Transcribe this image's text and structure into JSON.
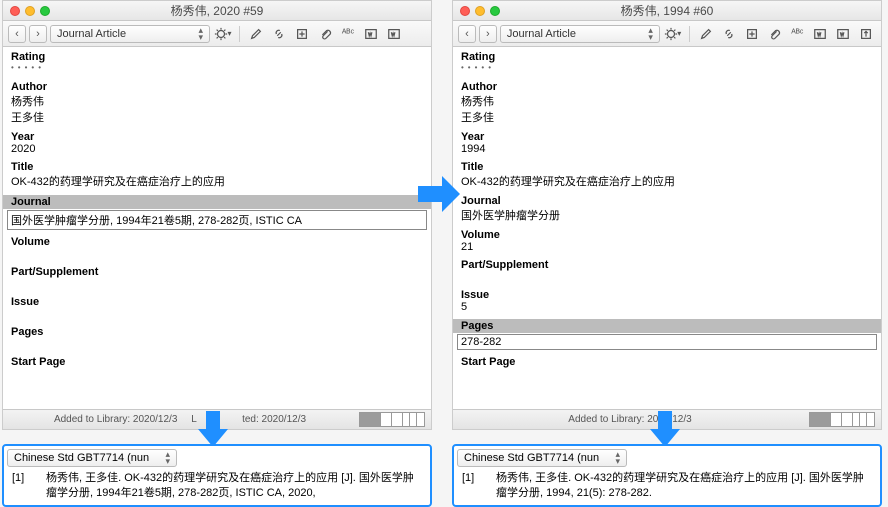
{
  "left": {
    "window_title": "杨秀伟, 2020 #59",
    "ref_type": "Journal Article",
    "fields": {
      "rating_label": "Rating",
      "author_label": "Author",
      "author1": "杨秀伟",
      "author2": "王多佳",
      "year_label": "Year",
      "year": "2020",
      "title_label": "Title",
      "title": "OK-432的药理学研究及在癌症治疗上的应用",
      "journal_label": "Journal",
      "journal": "国外医学肿瘤学分册, 1994年21卷5期, 278-282页, ISTIC CA",
      "volume_label": "Volume",
      "volume": "",
      "part_label": "Part/Supplement",
      "part": "",
      "issue_label": "Issue",
      "issue": "",
      "pages_label": "Pages",
      "pages": "",
      "startpage_label": "Start Page"
    },
    "status": {
      "added": "Added to Library: 2020/12/3",
      "updated_prefix": "L",
      "updated_suffix": "ted: 2020/12/3"
    },
    "preview": {
      "style": "Chinese Std GBT7714 (nun",
      "num": "[1]",
      "text": "杨秀伟, 王多佳. OK-432的药理学研究及在癌症治疗上的应用 [J]. 国外医学肿瘤学分册, 1994年21卷5期, 278-282页, ISTIC CA, 2020,"
    }
  },
  "right": {
    "window_title": "杨秀伟, 1994 #60",
    "ref_type": "Journal Article",
    "fields": {
      "rating_label": "Rating",
      "author_label": "Author",
      "author1": "杨秀伟",
      "author2": "王多佳",
      "year_label": "Year",
      "year": "1994",
      "title_label": "Title",
      "title": "OK-432的药理学研究及在癌症治疗上的应用",
      "journal_label": "Journal",
      "journal": "国外医学肿瘤学分册",
      "volume_label": "Volume",
      "volume": "21",
      "part_label": "Part/Supplement",
      "part": "",
      "issue_label": "Issue",
      "issue": "5",
      "pages_label": "Pages",
      "pages": "278-282",
      "startpage_label": "Start Page"
    },
    "status": {
      "added": "Added to Library: 2020/12/3",
      "updated": " "
    },
    "preview": {
      "style": "Chinese Std GBT7714 (nun",
      "num": "[1]",
      "text": "杨秀伟, 王多佳. OK-432的药理学研究及在癌症治疗上的应用 [J]. 国外医学肿瘤学分册, 1994, 21(5): 278-282."
    }
  }
}
